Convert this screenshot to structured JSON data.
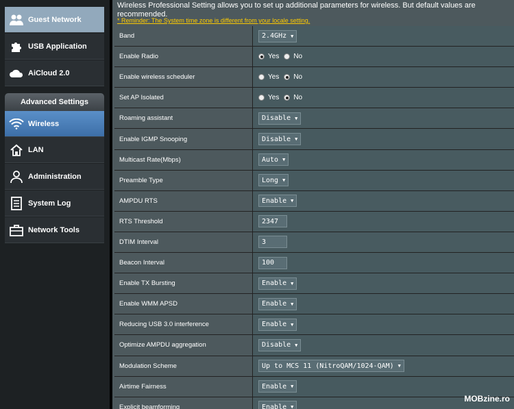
{
  "sidebar": {
    "items_top": [
      {
        "label": "Guest Network",
        "icon": "users-icon"
      },
      {
        "label": "USB Application",
        "icon": "puzzle-icon"
      },
      {
        "label": "AiCloud 2.0",
        "icon": "cloud-icon"
      }
    ],
    "advanced_header": "Advanced Settings",
    "items_adv": [
      {
        "label": "Wireless",
        "icon": "wifi-icon"
      },
      {
        "label": "LAN",
        "icon": "home-icon"
      },
      {
        "label": "Administration",
        "icon": "user-icon"
      },
      {
        "label": "System Log",
        "icon": "document-icon"
      },
      {
        "label": "Network Tools",
        "icon": "toolbox-icon"
      }
    ]
  },
  "main": {
    "description": "Wireless Professional Setting allows you to set up additional parameters for wireless. But default values are recommended.",
    "reminder": "* Reminder: The System time zone is different from your locale setting.",
    "rows": [
      {
        "label": "Band",
        "type": "select",
        "value": "2.4GHz"
      },
      {
        "label": "Enable Radio",
        "type": "radio",
        "yes": "Yes",
        "no": "No",
        "selected": "yes"
      },
      {
        "label": "Enable wireless scheduler",
        "type": "radio",
        "yes": "Yes",
        "no": "No",
        "selected": "no"
      },
      {
        "label": "Set AP Isolated",
        "type": "radio",
        "yes": "Yes",
        "no": "No",
        "selected": "no"
      },
      {
        "label": "Roaming assistant",
        "type": "select",
        "value": "Disable"
      },
      {
        "label": "Enable IGMP Snooping",
        "type": "select",
        "value": "Disable"
      },
      {
        "label": "Multicast Rate(Mbps)",
        "type": "select",
        "value": "Auto"
      },
      {
        "label": "Preamble Type",
        "type": "select",
        "value": "Long"
      },
      {
        "label": "AMPDU RTS",
        "type": "select",
        "value": "Enable"
      },
      {
        "label": "RTS Threshold",
        "type": "input",
        "value": "2347"
      },
      {
        "label": "DTIM Interval",
        "type": "input",
        "value": "3"
      },
      {
        "label": "Beacon Interval",
        "type": "input",
        "value": "100"
      },
      {
        "label": "Enable TX Bursting",
        "type": "select",
        "value": "Enable"
      },
      {
        "label": "Enable WMM APSD",
        "type": "select",
        "value": "Enable"
      },
      {
        "label": "Reducing USB 3.0 interference",
        "type": "select",
        "value": "Enable"
      },
      {
        "label": "Optimize AMPDU aggregation",
        "type": "select",
        "value": "Disable"
      },
      {
        "label": "Modulation Scheme",
        "type": "select",
        "value": "Up to MCS 11 (NitroQAM/1024-QAM)"
      },
      {
        "label": "Airtime Fairness",
        "type": "select",
        "value": "Enable"
      },
      {
        "label": "Explicit beamforming",
        "type": "select",
        "value": "Enable"
      }
    ]
  },
  "watermark": "MOBzine.ro"
}
